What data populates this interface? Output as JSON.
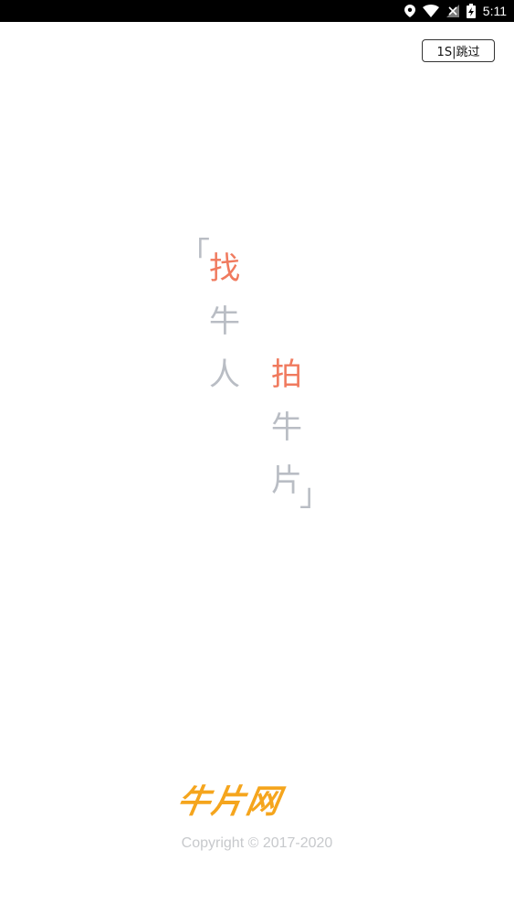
{
  "status_bar": {
    "time": "5:11",
    "icons": [
      "location-icon",
      "wifi-icon",
      "signal-icon",
      "battery-charging-icon"
    ]
  },
  "skip_button": {
    "label": "1S|跳过"
  },
  "slogan": {
    "open_bracket": "「",
    "close_bracket": "」",
    "column1": [
      "找",
      "牛",
      "人"
    ],
    "column2": [
      "拍",
      "牛",
      "片"
    ],
    "accent_color": "#f07a5e",
    "muted_color": "#b9bdc4"
  },
  "logo": {
    "text": "牛片网",
    "color": "#f5a51d"
  },
  "footer": {
    "copyright": "Copyright © 2017-2020",
    "color": "#c7c9cc"
  }
}
